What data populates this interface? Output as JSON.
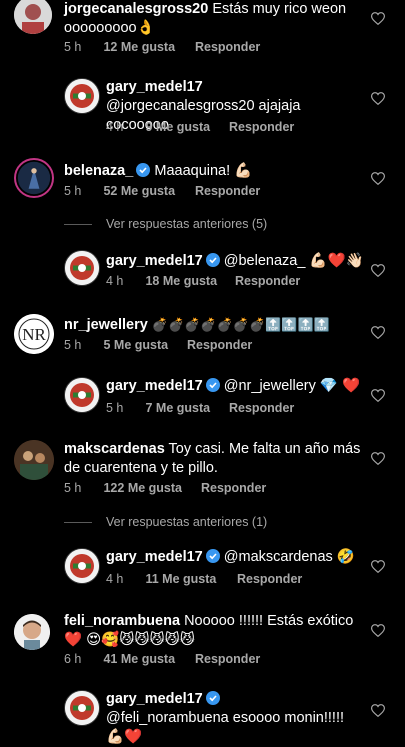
{
  "comments": [
    {
      "user": "jorgecanalesgross20",
      "text": "Estás muy rico weon ooooooooo👌",
      "time": "5 h",
      "likes": "12 Me gusta",
      "reply": "Responder"
    },
    {
      "user": "gary_medel17",
      "text": "@jorgecanalesgross20 ajajaja cocooooo",
      "time": "4 h",
      "likes": "9 Me gusta",
      "reply": "Responder"
    },
    {
      "user": "belenaza_",
      "text": "Maaaquina! 💪🏻",
      "time": "5 h",
      "likes": "52 Me gusta",
      "reply": "Responder"
    },
    {
      "view_more": "Ver respuestas anteriores (5)"
    },
    {
      "user": "gary_medel17",
      "text": "@belenaza_ 💪🏻❤️👋🏻",
      "time": "4 h",
      "likes": "18 Me gusta",
      "reply": "Responder"
    },
    {
      "user": "nr_jewellery",
      "text": "💣💣💣💣💣💣💣🔝🔝🔝🔝",
      "time": "5 h",
      "likes": "5 Me gusta",
      "reply": "Responder"
    },
    {
      "user": "gary_medel17",
      "text": "@nr_jewellery 💎 ❤️",
      "time": "5 h",
      "likes": "7 Me gusta",
      "reply": "Responder"
    },
    {
      "user": "makscardenas",
      "text": "Toy casi. Me falta un año más de cuarentena y te pillo.",
      "time": "5 h",
      "likes": "122 Me gusta",
      "reply": "Responder"
    },
    {
      "view_more": "Ver respuestas anteriores (1)"
    },
    {
      "user": "gary_medel17",
      "text": "@makscardenas 🤣",
      "time": "4 h",
      "likes": "11 Me gusta",
      "reply": "Responder"
    },
    {
      "user": "feli_norambuena",
      "text": "Nooooo !!!!!! Estás exótico❤️ 😍🥰😼😼😼😼😼",
      "time": "6 h",
      "likes": "41 Me gusta",
      "reply": "Responder"
    },
    {
      "user": "gary_medel17",
      "text": "@feli_norambuena esoooo monin!!!!! 💪🏻❤️",
      "time": "",
      "likes": "",
      "reply": ""
    }
  ],
  "icons": {
    "heart": "heart-outline-icon",
    "verified": "verified-badge-icon"
  },
  "colors": {
    "background": "#000000",
    "meta": "#a8a8a8",
    "verified": "#3897f0"
  }
}
